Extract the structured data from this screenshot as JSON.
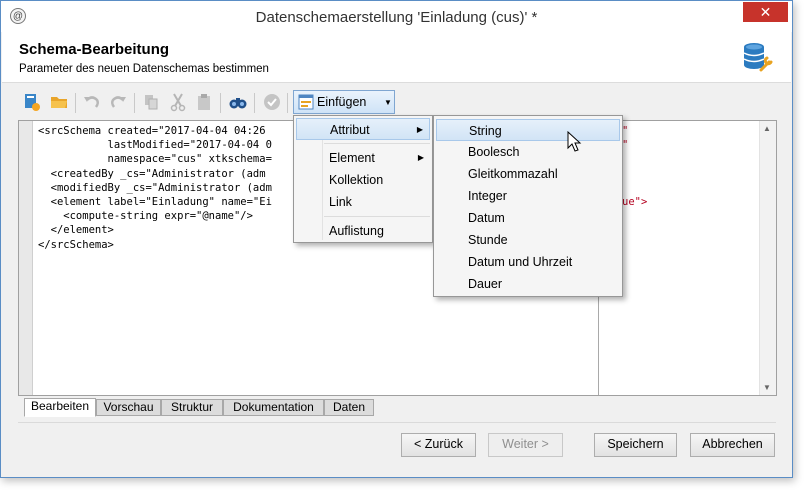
{
  "window": {
    "title": "Datenschemaerstellung 'Einladung (cus)' *",
    "close_label": "✕"
  },
  "header": {
    "title": "Schema-Bearbeitung",
    "subtitle": "Parameter des neuen Datenschemas bestimmen",
    "icon": "database-wrench-icon"
  },
  "toolbar": {
    "items": [
      "new-schema-icon",
      "open-folder-icon",
      "undo-icon",
      "redo-icon",
      "copy-icon",
      "cut-icon",
      "paste-icon",
      "find-icon",
      "validate-icon"
    ],
    "insert_label": "Einfügen"
  },
  "editor": {
    "lines": [
      "<srcSchema created=\"2017-04-04 04:26",
      "           lastModified=\"2017-04-04 0",
      "           namespace=\"cus\" xtkschema=",
      "  <createdBy _cs=\"Administrator (adm",
      "  <modifiedBy _cs=\"Administrator (adm",
      "  <element label=\"Einladung\" name=\"Ei",
      "    <compute-string expr=\"@name\"/>",
      "  </element>",
      "</srcSchema>"
    ],
    "right_fragments": [
      "\"",
      "\"",
      "ue\">"
    ]
  },
  "tabs": [
    "Bearbeiten",
    "Vorschau",
    "Struktur",
    "Dokumentation",
    "Daten"
  ],
  "insert_menu": {
    "items": [
      "Attribut",
      "Element",
      "Kollektion",
      "Link",
      "Auflistung"
    ]
  },
  "attribute_submenu": {
    "items": [
      "String",
      "Boolesch",
      "Gleitkommazahl",
      "Integer",
      "Datum",
      "Stunde",
      "Datum und Uhrzeit",
      "Dauer"
    ]
  },
  "footer": {
    "back": "< Zurück",
    "next": "Weiter >",
    "save": "Speichern",
    "cancel": "Abbrechen"
  }
}
